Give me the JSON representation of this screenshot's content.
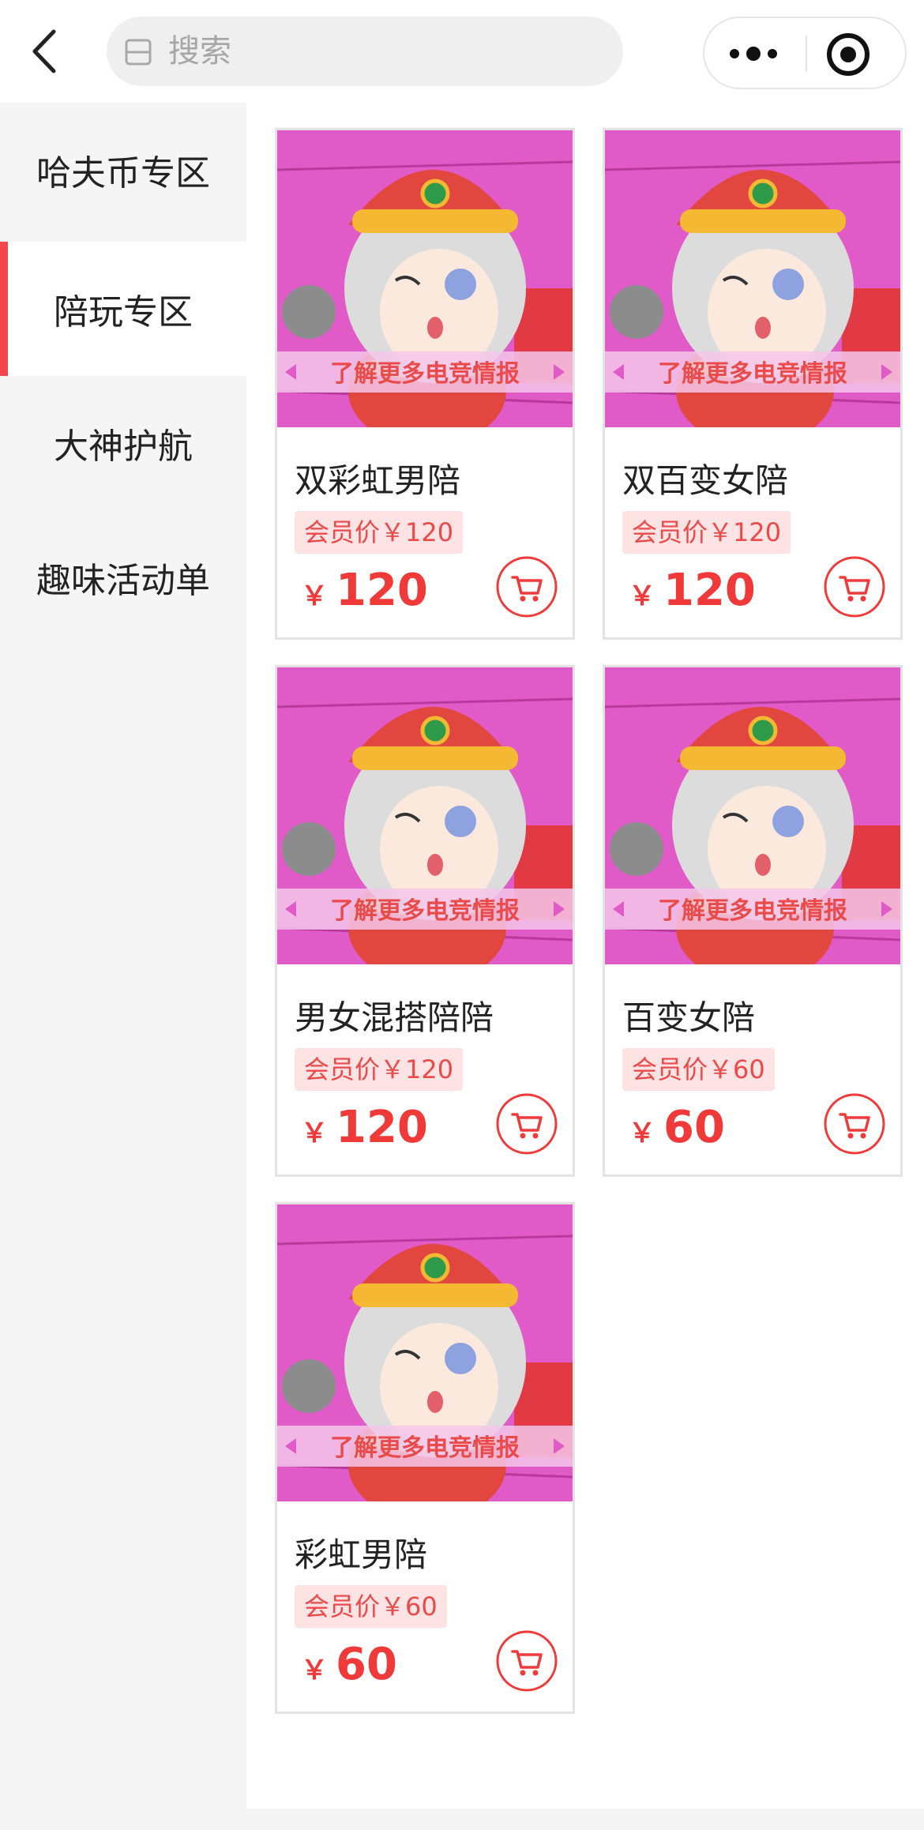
{
  "header": {
    "search_placeholder": "搜索"
  },
  "sidebar": {
    "items": [
      {
        "label": "哈夫币专区"
      },
      {
        "label": "陪玩专区"
      },
      {
        "label": "大神护航"
      },
      {
        "label": "趣味活动单"
      }
    ],
    "active_index": 1
  },
  "banner": {
    "caption": "了解更多电竞情报"
  },
  "products": [
    {
      "title": "双彩虹男陪",
      "member_price": "会员价￥120",
      "currency": "￥",
      "price": "120"
    },
    {
      "title": "双百变女陪",
      "member_price": "会员价￥120",
      "currency": "￥",
      "price": "120"
    },
    {
      "title": "男女混搭陪陪",
      "member_price": "会员价￥120",
      "currency": "￥",
      "price": "120"
    },
    {
      "title": "百变女陪",
      "member_price": "会员价￥60",
      "currency": "￥",
      "price": "60"
    },
    {
      "title": "彩虹男陪",
      "member_price": "会员价￥60",
      "currency": "￥",
      "price": "60"
    }
  ],
  "colors": {
    "accent": "#f03a3a",
    "badge_bg": "#fde3e3",
    "banner_bg": "#e05bc7"
  },
  "icons": [
    "back-arrow-icon",
    "search-icon",
    "more-dots-icon",
    "target-icon",
    "cart-icon"
  ]
}
